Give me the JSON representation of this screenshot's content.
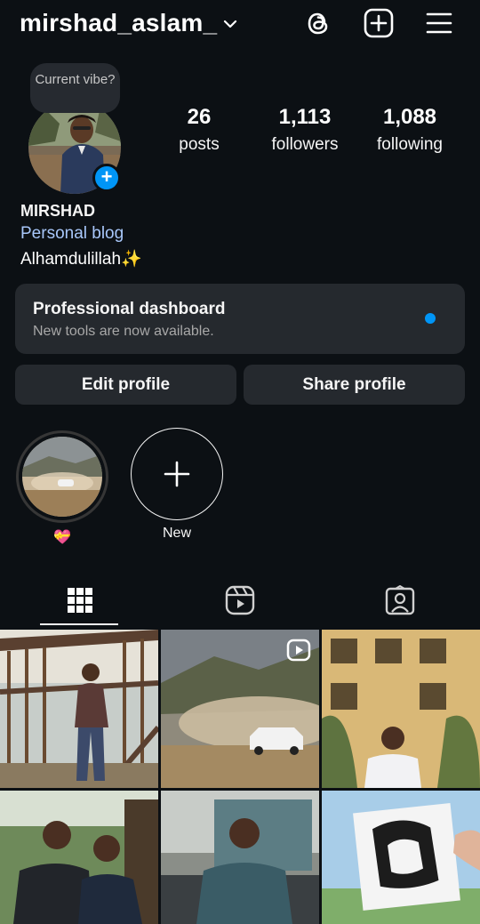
{
  "header": {
    "username": "mirshad_aslam_",
    "icons": [
      "chevron-down-icon",
      "threads-icon",
      "create-plus-icon",
      "menu-icon"
    ]
  },
  "profile": {
    "vibe_prompt": "Current vibe?",
    "stats": [
      {
        "value": "26",
        "label": "posts"
      },
      {
        "value": "1,113",
        "label": "followers"
      },
      {
        "value": "1,088",
        "label": "following"
      }
    ],
    "name": "MIRSHAD",
    "category": "Personal blog",
    "bio": "Alhamdulillah✨"
  },
  "dashboard": {
    "title": "Professional dashboard",
    "subtitle": "New tools are now available."
  },
  "actions": {
    "edit": "Edit profile",
    "share": "Share profile"
  },
  "highlights": [
    {
      "label": "💝"
    },
    {
      "label": "New"
    }
  ],
  "tabs": [
    "posts-grid-icon",
    "reels-icon",
    "tagged-icon"
  ],
  "colors": {
    "background": "#0c1014",
    "accent": "#0095f6",
    "link": "#a8c7fa",
    "card": "#25292e"
  }
}
